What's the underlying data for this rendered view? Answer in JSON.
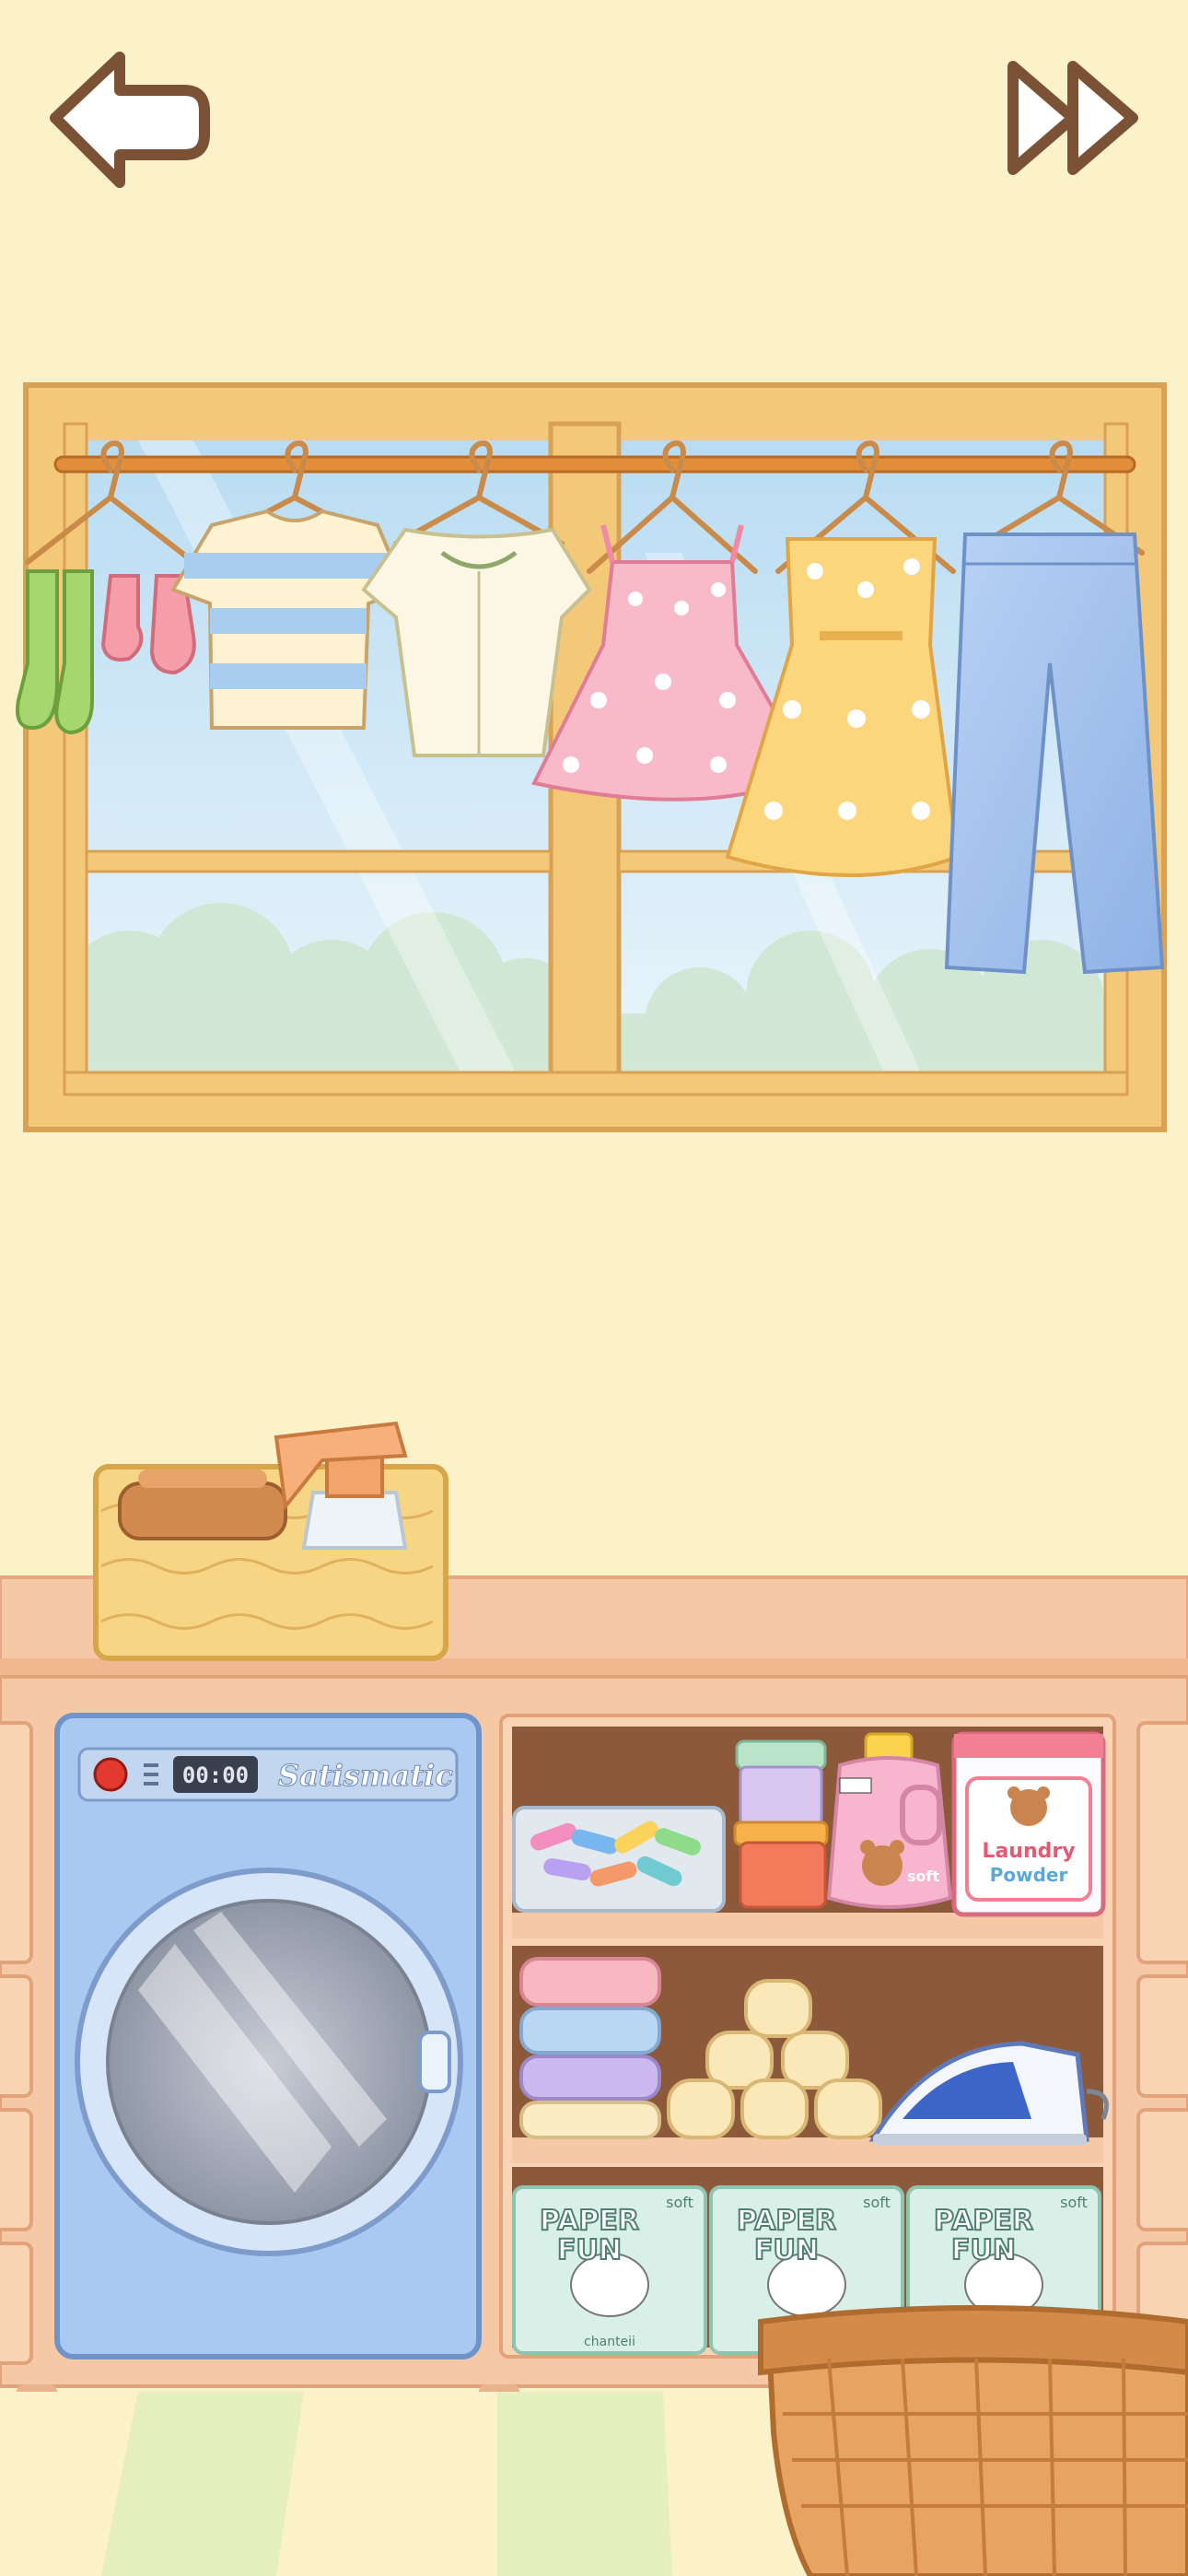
{
  "nav": {
    "back_icon": "back-arrow-icon",
    "skip_icon": "fast-forward-icon"
  },
  "washer": {
    "timer": "00:00",
    "brand": "Satismatic"
  },
  "shelf": {
    "powder_label_line1": "Laundry",
    "powder_label_line2": "Powder",
    "detergent_label": "soft",
    "paper_label_line1": "PAPER",
    "paper_label_line2": "FUN",
    "paper_soft": "soft",
    "paper_brand": "chanteii"
  },
  "colors": {
    "wall": "#fbf2c9",
    "window_frame": "#f3c879",
    "counter": "#f6c9a6",
    "washer_body": "#a9c8f2",
    "shelf_inside": "#8c5a3a",
    "floor_stripe": "#e5efbf"
  },
  "hanging_items": [
    "socks",
    "striped-tshirt",
    "cream-blouse",
    "pink-floral-dress",
    "yellow-polka-dress",
    "blue-jeans"
  ]
}
